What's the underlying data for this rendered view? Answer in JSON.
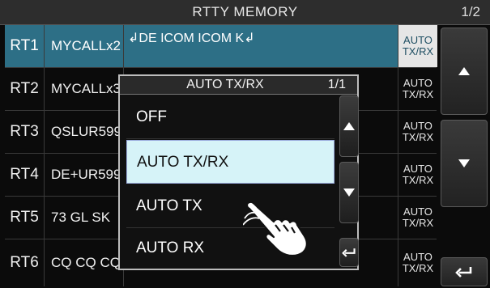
{
  "header": {
    "title": "RTTY MEMORY",
    "page": "1/2"
  },
  "rows": [
    {
      "id": "RT1",
      "name": "MYCALLx2",
      "content": "↲DE ICOM ICOM K↲",
      "mode_line1": "AUTO",
      "mode_line2": "TX/RX"
    },
    {
      "id": "RT2",
      "name": "MYCALLx3",
      "content": "",
      "mode_line1": "AUTO",
      "mode_line2": "TX/RX"
    },
    {
      "id": "RT3",
      "name": "QSLUR599",
      "content": "",
      "mode_line1": "AUTO",
      "mode_line2": "TX/RX"
    },
    {
      "id": "RT4",
      "name": "DE+UR599",
      "content": "",
      "mode_line1": "AUTO",
      "mode_line2": "TX/RX"
    },
    {
      "id": "RT5",
      "name": "73 GL SK",
      "content": "",
      "mode_line1": "AUTO",
      "mode_line2": "TX/RX"
    },
    {
      "id": "RT6",
      "name": "CQ CQ CQ",
      "content": "",
      "mode_line1": "AUTO",
      "mode_line2": "TX/RX"
    }
  ],
  "dialog": {
    "title": "AUTO TX/RX",
    "page": "1/1",
    "options": [
      "OFF",
      "AUTO TX/RX",
      "AUTO TX",
      "AUTO RX"
    ],
    "selected_index": 1
  },
  "icons": {
    "side_up": "triangle-up-icon",
    "side_down": "triangle-down-icon",
    "back": "return-arrow-icon",
    "touch": "pointing-hand-icon"
  },
  "colors": {
    "selected_row": "#2d6f86",
    "selected_option": "#d6f3f8"
  }
}
